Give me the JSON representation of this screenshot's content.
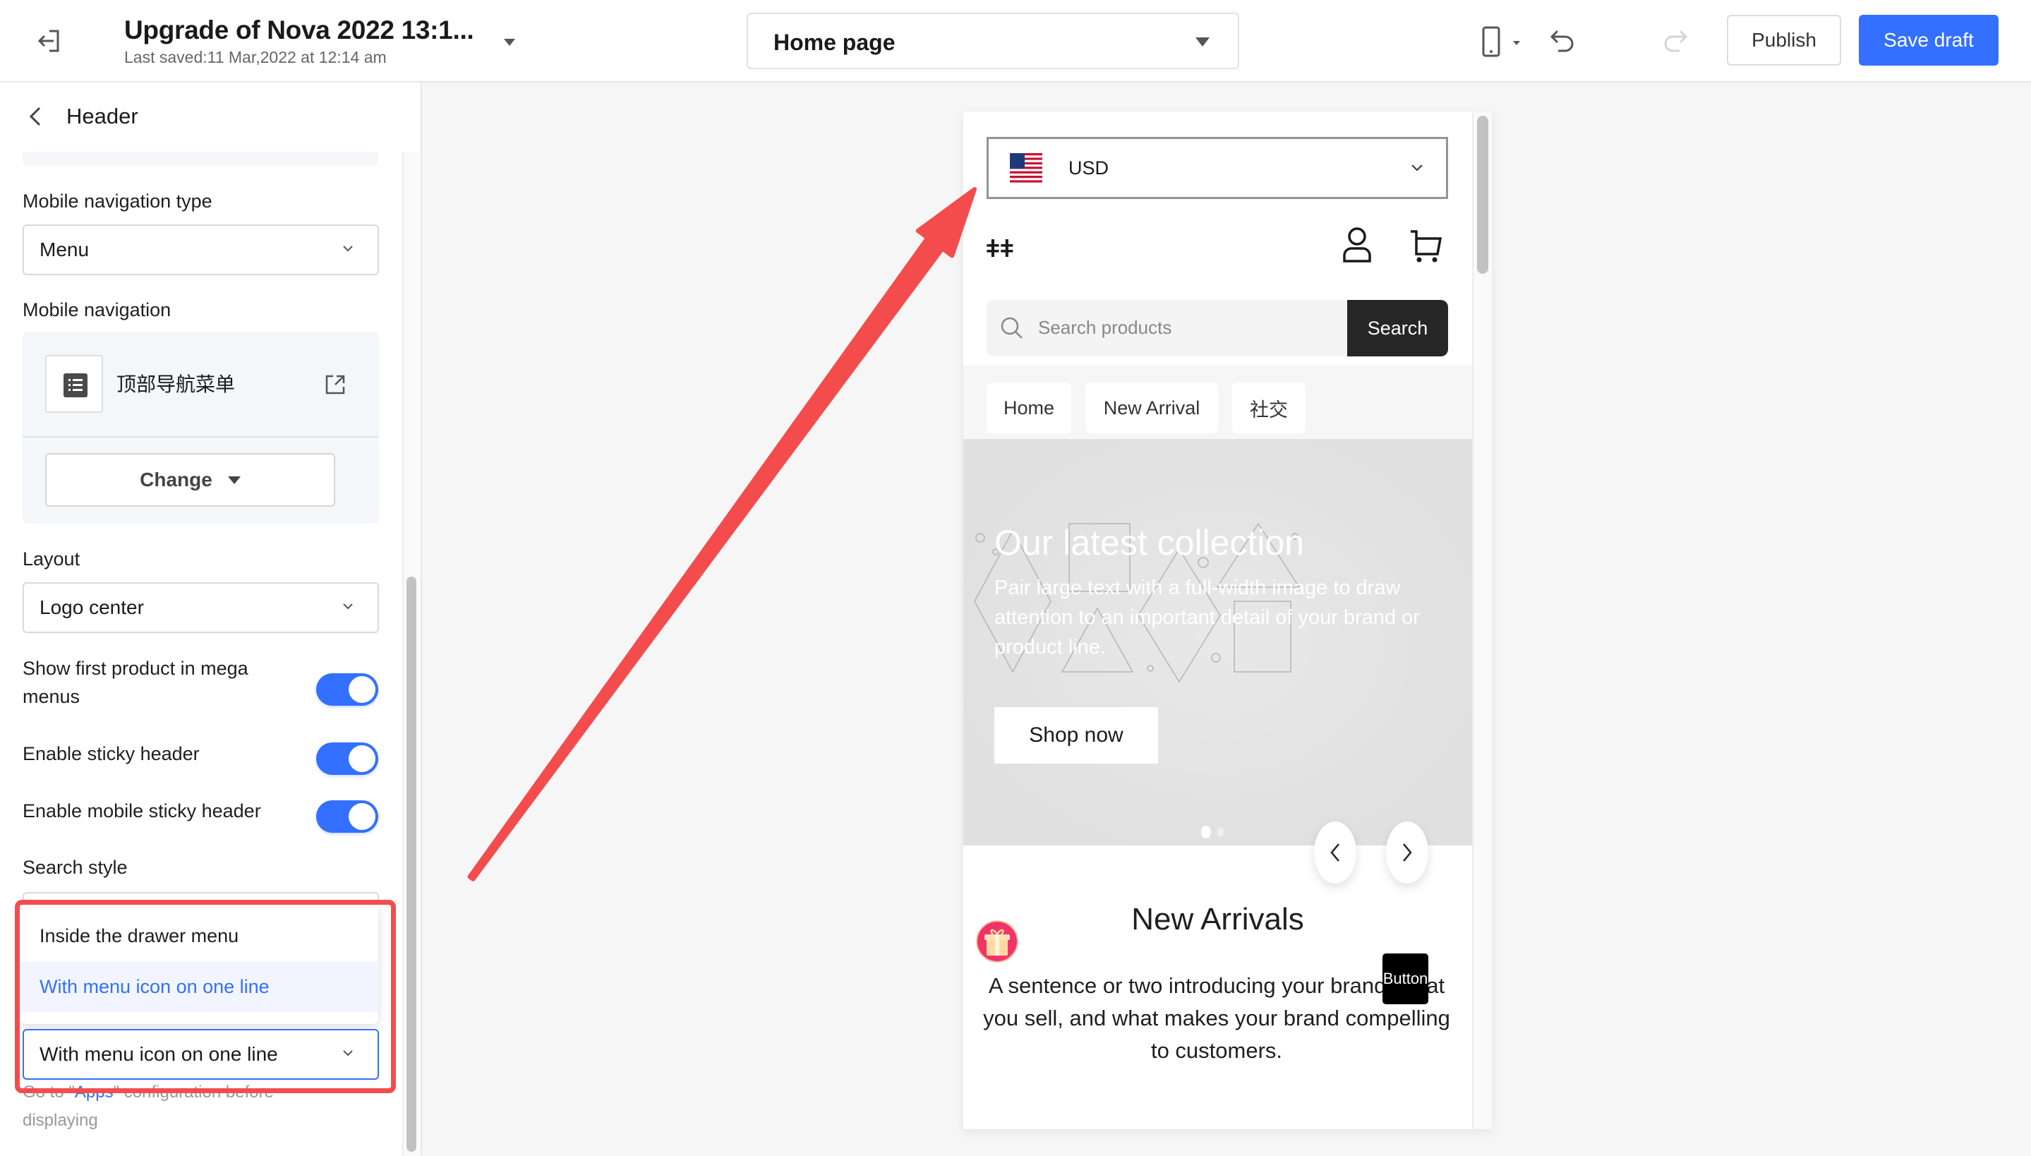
{
  "topbar": {
    "title": "Upgrade of Nova 2022 13:1...",
    "last_saved": "Last saved:11 Mar,2022 at 12:14 am",
    "page_select": "Home page",
    "publish_label": "Publish",
    "save_label": "Save draft",
    "icons": [
      "exit-icon",
      "caret-down-icon",
      "mobile-device-icon",
      "undo-icon",
      "redo-icon"
    ]
  },
  "panel": {
    "back_icon": "chevron-left-icon",
    "title": "Header",
    "mobile_nav_type": {
      "label": "Mobile navigation type",
      "value": "Menu"
    },
    "mobile_nav": {
      "label": "Mobile navigation",
      "menu_name": "顶部导航菜单",
      "change_label": "Change"
    },
    "layout": {
      "label": "Layout",
      "value": "Logo center"
    },
    "toggles": [
      {
        "label": "Show first product in mega menus",
        "on": true
      },
      {
        "label": "Enable sticky header",
        "on": true
      },
      {
        "label": "Enable mobile sticky header",
        "on": true
      }
    ],
    "search_style": {
      "label": "Search style",
      "value": "With menu icon on one line",
      "options": [
        {
          "label": "Inside the drawer menu",
          "selected": false
        },
        {
          "label": "With menu icon on one line",
          "selected": true
        }
      ]
    },
    "helper": {
      "before": "Go to \"",
      "link": "Apps",
      "after": "\" configuration before displaying"
    }
  },
  "preview": {
    "currency": "USD",
    "logo": "ǂǂ",
    "search_placeholder": "Search products",
    "search_button": "Search",
    "nav_items": [
      "Home",
      "New Arrival",
      "社交"
    ],
    "hero": {
      "title": "Our latest collection",
      "subtitle": "Pair large text with a full-width image to draw attention to an important detail of your brand or product line.",
      "button": "Shop now",
      "slide_count": 2,
      "active_slide": 1
    },
    "new_arrivals": {
      "title": "New Arrivals",
      "description": "A sentence or two introducing your brand, what you sell, and what makes your brand compelling to customers."
    },
    "floating_button": "Button"
  },
  "colors": {
    "accent": "#3370ff",
    "annotation": "#f44c4c"
  }
}
